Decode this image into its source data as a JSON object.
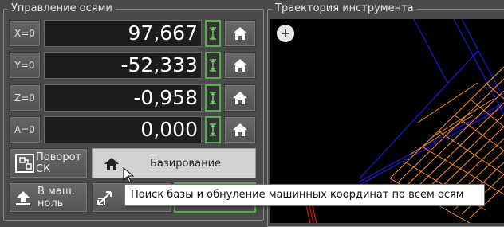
{
  "axes_panel": {
    "title": "Управление осями",
    "axes": [
      {
        "zero_label": "X=0",
        "value": "97,667"
      },
      {
        "zero_label": "Y=0",
        "value": "-52,333"
      },
      {
        "zero_label": "Z=0",
        "value": "-0,958"
      },
      {
        "zero_label": "A=0",
        "value": "0,000"
      }
    ],
    "rotate_cs_label_1": "Поворот",
    "rotate_cs_label_2": "СК",
    "homing_label": "Базирование",
    "to_machine_zero_label_1": "В маш.",
    "to_machine_zero_label_2": "ноль"
  },
  "trajectory_panel": {
    "title": "Траектория инструмента"
  },
  "tooltip": {
    "text": "Поиск базы и обнуление машинных координат по всем осям"
  },
  "colors": {
    "background": "#4a4a4a",
    "value_field": "#1c1c1c",
    "measure_accent": "#52b04a",
    "toolpath_orange": "#ff8c1a",
    "toolpath_blue": "#1a1aff",
    "toolpath_red": "#e01010"
  },
  "icons": [
    "home-icon",
    "measure-icon",
    "rotate-cs-icon",
    "machine-zero-icon",
    "move-axes-icon",
    "zoom-in-icon",
    "cursor-icon"
  ]
}
